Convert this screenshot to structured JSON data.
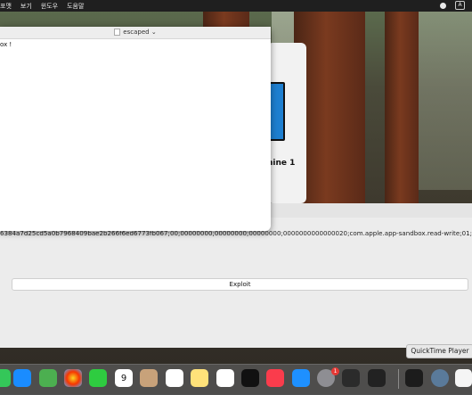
{
  "menubar": {
    "items": [
      "포맷",
      "보기",
      "윈도우",
      "도움말"
    ],
    "right_letter": "A"
  },
  "textedit": {
    "title": "escaped",
    "body_text": "ox !"
  },
  "machine_card": {
    "label": "hine 1"
  },
  "app": {
    "sandbox_text": "6384a7d25cd5a0b7968409bae2b266f6ed6773fb067;00;00000000;00000000;00000000;0000000000000020;com.apple.app-sandbox.read-write;01;010000",
    "exploit_button_label": "Exploit"
  },
  "tooltip": {
    "label": "QuickTime Player"
  },
  "dock": {
    "calendar_month": "10월",
    "calendar_day": "9",
    "settings_badge": "1",
    "apps": [
      {
        "name": "messages",
        "color": "#34c759"
      },
      {
        "name": "mail",
        "color": "#1a8cff"
      },
      {
        "name": "maps",
        "color": "#4caf50"
      },
      {
        "name": "photos",
        "color": "#f0f0f0"
      },
      {
        "name": "facetime",
        "color": "#2ecc40"
      },
      {
        "name": "calendar",
        "color": "#ffffff"
      },
      {
        "name": "contacts",
        "color": "#c8a27a"
      },
      {
        "name": "reminders",
        "color": "#ffffff"
      },
      {
        "name": "notes",
        "color": "#ffe27a"
      },
      {
        "name": "freeform",
        "color": "#ffffff"
      },
      {
        "name": "appletv",
        "color": "#111111"
      },
      {
        "name": "music",
        "color": "#fa3c4c"
      },
      {
        "name": "appstore",
        "color": "#1e90ff"
      },
      {
        "name": "systemsettings",
        "color": "#8e8e93"
      },
      {
        "name": "console",
        "color": "#2b2b2b"
      },
      {
        "name": "terminal",
        "color": "#222222"
      },
      {
        "name": "activitymonitor",
        "color": "#1c1c1c"
      },
      {
        "name": "quicktime",
        "color": "#5a7a9a"
      },
      {
        "name": "textedit",
        "color": "#f5f5f5"
      }
    ]
  }
}
